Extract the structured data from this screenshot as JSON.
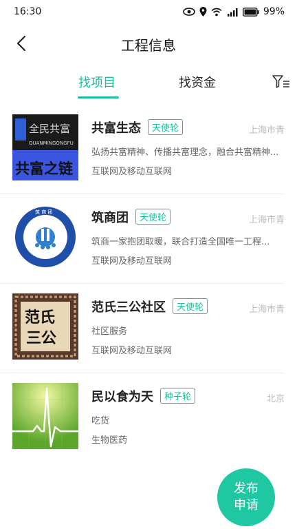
{
  "status_bar": {
    "time": "16:30",
    "battery": "99%"
  },
  "header": {
    "title": "工程信息"
  },
  "tabs": [
    {
      "label": "找项目"
    },
    {
      "label": "找资金"
    }
  ],
  "projects": [
    {
      "title": "共富生态",
      "round": "天使轮",
      "location": "上海市青",
      "desc": "弘扬共富精神、传播共富理念，融合共富精神...",
      "industry": "互联网及移动互联网",
      "thumb": {
        "top_text": "全民共富",
        "sub_text": "QUANMINGONGFU",
        "bottom_text": "共富之链"
      }
    },
    {
      "title": "筑商团",
      "round": "天使轮",
      "location": "上海市青",
      "desc": "筑商一家抱团取暖，联合打造全国唯一工程...",
      "industry": "互联网及移动互联网",
      "thumb": {
        "ring_text": "筑 商 团"
      }
    },
    {
      "title": "范氏三公社区",
      "round": "天使轮",
      "location": "上海市青",
      "desc": "社区服务",
      "industry": "互联网及移动互联网",
      "thumb": {
        "line1": "范氏",
        "line2": "三公"
      }
    },
    {
      "title": "民以食为天",
      "round": "种子轮",
      "location": "北京",
      "desc": "吃货",
      "industry": "生物医药"
    }
  ],
  "fab": {
    "line1": "发布",
    "line2": "申请"
  },
  "colors": {
    "accent": "#1bbf9f",
    "fab": "#20c7a3"
  }
}
